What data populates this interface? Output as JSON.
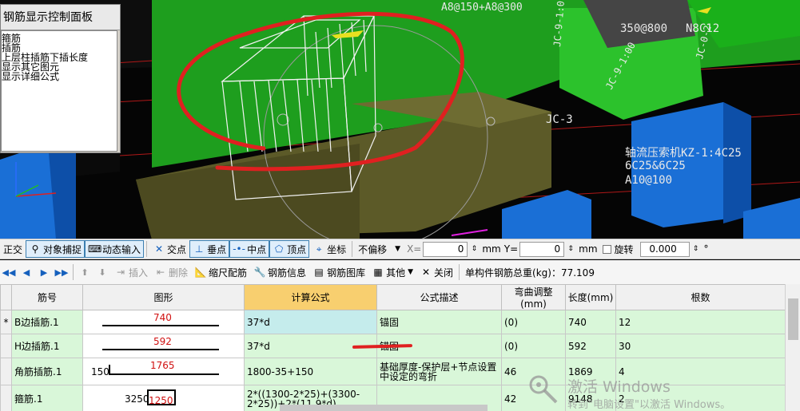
{
  "viewport": {
    "labels": {
      "top_rebar": "A8@150+A8@300",
      "right_top_a": "350@800",
      "right_top_b": "N8C12",
      "jc3": "JC-3",
      "jc9a": "JC-9-1:0",
      "jc9b": "JC-9-1:00",
      "jc9c": "JC-0-2",
      "kz1_line1": "轴流压索机KZ-1:4C25",
      "kz1_line2": "6C25&6C25",
      "kz1_line3": "A10@100"
    },
    "colors": {
      "green": "#1eb81e",
      "blue": "#1a6fd6",
      "olive": "#5a5a26",
      "annotation_red": "#e02020"
    }
  },
  "control_panel": {
    "title": "钢筋显示控制面板",
    "items": [
      "箍筋",
      "插筋",
      "上层柱插筋下插长度",
      "显示其它图元",
      "显示详细公式"
    ]
  },
  "snap_toolbar": {
    "ortho": "正交",
    "object_snap": "对象捕捉",
    "dynamic_input": "动态输入",
    "intersection": "交点",
    "perpendicular": "垂点",
    "midpoint": "中点",
    "vertex": "顶点",
    "coordinate": "坐标",
    "offset_mode": "不偏移",
    "x_label": "X=",
    "x_value": "0",
    "y_label": "Y=",
    "y_value": "0",
    "unit": "mm",
    "rotate": "旋转",
    "rotate_value": "0.000",
    "degree": "°"
  },
  "rebar_toolbar": {
    "insert": "插入",
    "delete": "删除",
    "scale_rebar": "缩尺配筋",
    "rebar_info": "钢筋信息",
    "rebar_library": "钢筋图库",
    "other": "其他",
    "close": "关闭",
    "total_weight": "单构件钢筋总重(kg)：77.109"
  },
  "table": {
    "headers": [
      "筋号",
      "图形",
      "计算公式",
      "公式描述",
      "弯曲调整(mm)",
      "长度(mm)",
      "根数"
    ],
    "rows": [
      {
        "marker": "*",
        "name": "B边插筋.1",
        "fig_prefix": "",
        "fig_value": "740",
        "formula": "37*d",
        "desc": "锚固",
        "bend": "(0)",
        "length": "740",
        "count": "12"
      },
      {
        "marker": "",
        "name": "H边插筋.1",
        "fig_prefix": "",
        "fig_value": "592",
        "formula": "37*d",
        "desc": "锚固",
        "bend": "(0)",
        "length": "592",
        "count": "30"
      },
      {
        "marker": "",
        "name": "角筋插筋.1",
        "fig_prefix": "150",
        "fig_value": "1765",
        "formula": "1800-35+150",
        "desc": "基础厚度-保护层+节点设置中设定的弯折",
        "bend": "46",
        "length": "1869",
        "count": "4"
      },
      {
        "marker": "",
        "name": "箍筋.1",
        "fig_prefix": "3250",
        "fig_value": "1250",
        "formula": "2*((1300-2*25)+(3300-2*25))+2*(11.9*d)",
        "desc": "",
        "bend": "42",
        "length": "9148",
        "count": "2"
      }
    ]
  },
  "watermark": {
    "line1": "激活 Windows",
    "line2": "转到\"电脑设置\"以激活 Windows。"
  }
}
